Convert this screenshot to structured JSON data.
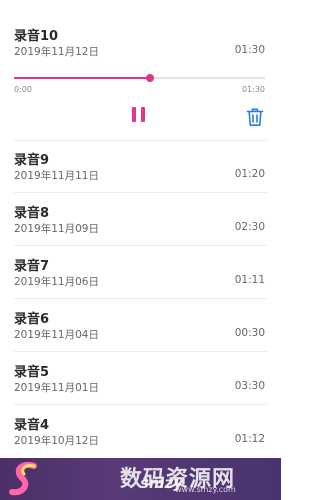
{
  "player": {
    "title": "录音10",
    "date": "2019年11月12日",
    "duration": "01:30",
    "current_time": "0:00",
    "total_time": "01:30",
    "progress": 0.54,
    "pause_icon": "pause-icon",
    "delete_icon": "trash-icon",
    "accent_color": "#e0368d",
    "delete_color": "#2a7fd4"
  },
  "recordings": [
    {
      "title": "录音9",
      "date": "2019年11月11日",
      "duration": "01:20"
    },
    {
      "title": "录音8",
      "date": "2019年11月09日",
      "duration": "02:30"
    },
    {
      "title": "录音7",
      "date": "2019年11月06日",
      "duration": "01:11"
    },
    {
      "title": "录音6",
      "date": "2019年11月04日",
      "duration": "00:30"
    },
    {
      "title": "录音5",
      "date": "2019年11月01日",
      "duration": "03:30"
    },
    {
      "title": "录音4",
      "date": "2019年10月12日",
      "duration": "01:12"
    }
  ],
  "watermark": {
    "text": "数码资源网",
    "brand": "smzy",
    "url": "www.smzy.com"
  }
}
